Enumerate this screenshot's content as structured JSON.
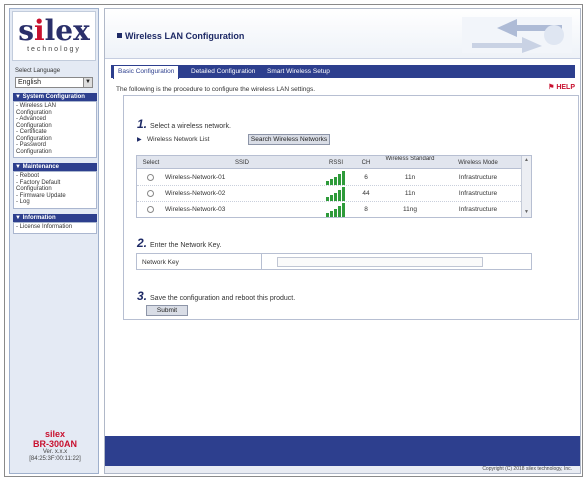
{
  "sidebar": {
    "logo_text": "silex",
    "logo_sub": "technology",
    "language_label": "Select Language",
    "language_value": "English",
    "groups": [
      {
        "title": "System Configuration",
        "items": [
          "- Wireless LAN",
          "  Configuration",
          "- Advanced",
          "  Configuration",
          "- Certificate",
          "  Configuration",
          "- Password",
          "  Configuration"
        ]
      },
      {
        "title": "Maintenance",
        "items": [
          "- Reboot",
          "- Factory Default",
          "  Configuration",
          "- Firmware Update",
          "- Log"
        ]
      },
      {
        "title": "Information",
        "items": [
          "- License Information"
        ]
      }
    ],
    "footer_brand": "silex",
    "footer_model": "BR-300AN",
    "footer_version": "Ver. x.x.x",
    "footer_mac": "[84:25:3F:00:11:22]"
  },
  "header": {
    "title": "Wireless LAN Configuration"
  },
  "tabs": [
    {
      "label": "Basic Configuration"
    },
    {
      "label": "Detailed Configuration"
    },
    {
      "label": "Smart Wireless Setup"
    }
  ],
  "content": {
    "intro": "The following is the procedure to configure the wireless LAN settings.",
    "help_label": "HELP",
    "step1_num": "1.",
    "step1_label": "Select a wireless network.",
    "network_list_label": "Wireless Network List",
    "search_button": "Search Wireless Networks",
    "table_headers": {
      "select": "Select",
      "ssid": "SSID",
      "rssi": "RSSI",
      "ch": "CH",
      "standard": "Wireless Standard",
      "mode": "Wireless Mode"
    },
    "networks": [
      {
        "ssid": "Wireless-Network-01",
        "ch": "6",
        "standard": "11n",
        "mode": "Infrastructure"
      },
      {
        "ssid": "Wireless-Network-02",
        "ch": "44",
        "standard": "11n",
        "mode": "Infrastructure"
      },
      {
        "ssid": "Wireless-Network-03",
        "ch": "8",
        "standard": "11ng",
        "mode": "Infrastructure"
      }
    ],
    "step2_num": "2.",
    "step2_label": "Enter the Network Key.",
    "network_key_label": "Network Key",
    "network_key_value": "",
    "step3_num": "3.",
    "step3_label": "Save the configuration and reboot this product.",
    "submit_button": "Submit"
  },
  "footer": {
    "copyright": "Copyright (C) 2018 silex technology, Inc."
  },
  "colors": {
    "nav_blue": "#2d3f8e",
    "brand_red": "#c8102e",
    "signal_green": "#2e9b3a"
  }
}
